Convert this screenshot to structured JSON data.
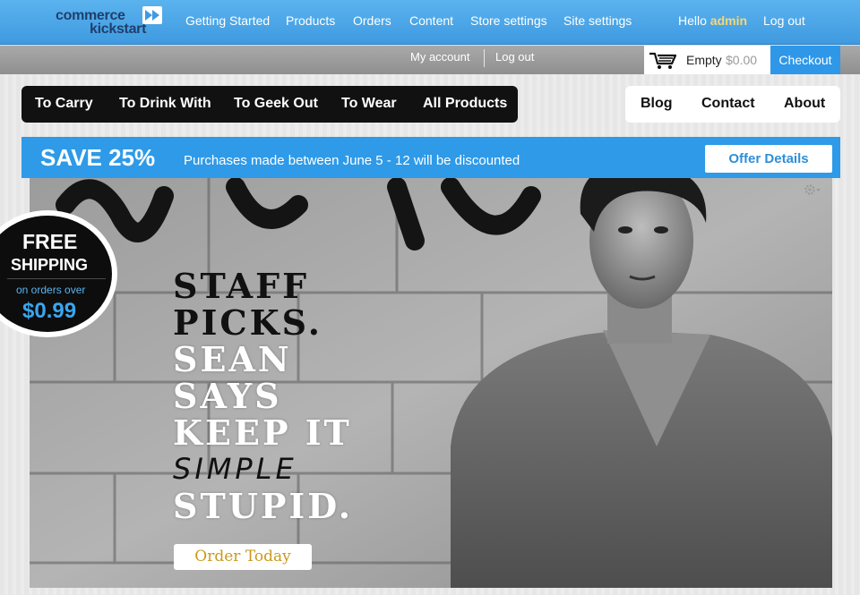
{
  "admin_bar": {
    "logo_line1": "commerce",
    "logo_line2": "kickstart",
    "menu": [
      "Getting Started",
      "Products",
      "Orders",
      "Content",
      "Store settings",
      "Site settings"
    ],
    "hello_prefix": "Hello",
    "hello_user": "admin",
    "logout": "Log out"
  },
  "account_bar": {
    "my_account": "My account",
    "logout": "Log out",
    "cart_status": "Empty",
    "cart_amount": "$0.00",
    "checkout": "Checkout"
  },
  "category_nav": [
    "To Carry",
    "To Drink With",
    "To Geek Out",
    "To Wear",
    "All Products"
  ],
  "page_nav": [
    "Blog",
    "Contact",
    "About"
  ],
  "promo": {
    "headline": "SAVE 25%",
    "message": "Purchases made between June 5 - 12 will be discounted",
    "button": "Offer Details"
  },
  "hero": {
    "lines": [
      "STAFF",
      "PICKS.",
      "SEAN",
      "SAYS",
      "KEEP IT",
      "SIMPLE",
      "STUPID."
    ],
    "cta": "Order Today"
  },
  "shipping_badge": {
    "line1": "FREE",
    "line2": "SHIPPING",
    "line3": "on orders over",
    "price": "$0.99"
  },
  "colors": {
    "accent": "#2e9ae8",
    "admin_bar": "#4aa6e8",
    "greeting": "#f7d775",
    "cta_text": "#c99a1d"
  }
}
